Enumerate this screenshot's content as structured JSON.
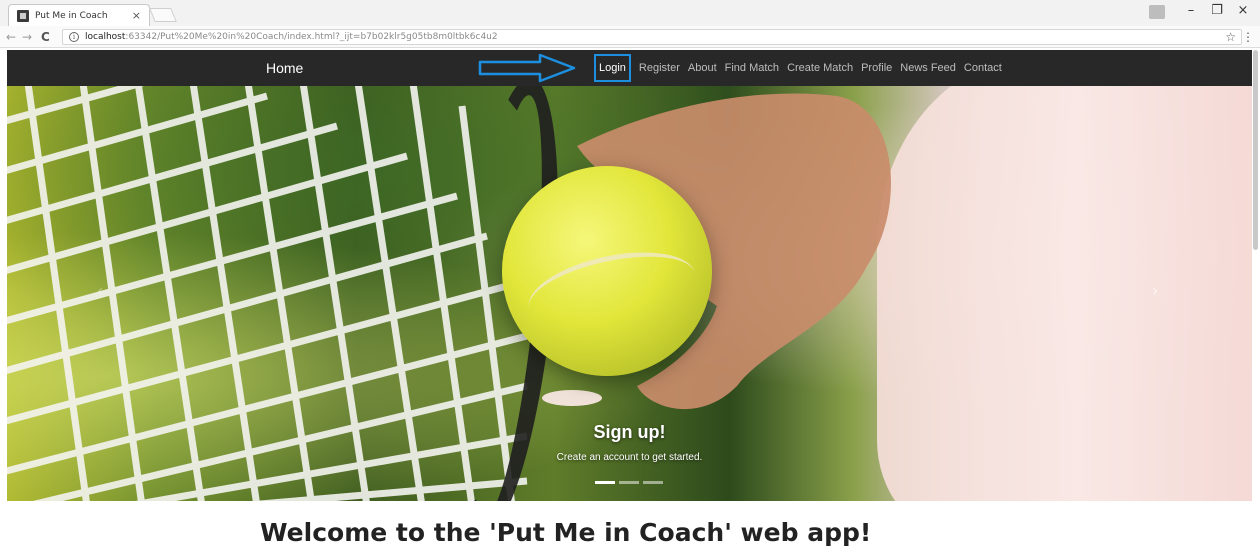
{
  "browser": {
    "tab_title": "Put Me in Coach",
    "tab_close": "×",
    "url_host": "localhost",
    "url_rest": ":63342/Put%20Me%20in%20Coach/index.html?_ijt=b7b02klr5g05tb8m0ltbk6c4u2",
    "back_glyph": "←",
    "forward_glyph": "→",
    "reload_glyph": "C",
    "star_glyph": "☆",
    "menu_glyph": "⋮",
    "minimize_glyph": "–",
    "restore_glyph": "❐",
    "close_glyph": "×"
  },
  "navbar": {
    "brand": "Home",
    "links": [
      "Login",
      "Register",
      "About",
      "Find Match",
      "Create Match",
      "Profile",
      "News Feed",
      "Contact"
    ],
    "active_link_index": 0,
    "highlight_color": "#1d8fe0"
  },
  "carousel": {
    "caption_title": "Sign up!",
    "caption_text": "Create an account to get started.",
    "slide_count": 3,
    "active_slide": 1,
    "prev_glyph": "‹",
    "next_glyph": "›"
  },
  "main": {
    "heading": "Welcome to the 'Put Me in Coach' web app!"
  },
  "icons": {
    "favicon": "app-favicon-icon",
    "info": "site-info-icon",
    "star": "bookmark-star-icon",
    "arrow": "annotation-arrow-icon"
  }
}
